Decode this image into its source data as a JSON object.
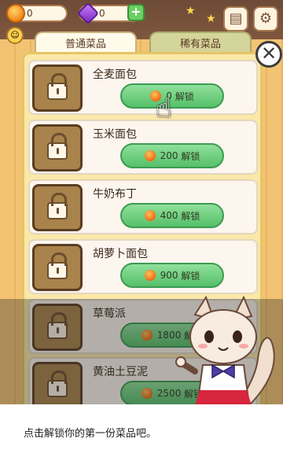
{
  "hud": {
    "coins": "0",
    "gems": "0",
    "plus": "+",
    "face": "☺",
    "icons": [
      "ticket-icon",
      "gear-icon"
    ]
  },
  "tabs": [
    {
      "label": "普通菜品",
      "active": true
    },
    {
      "label": "稀有菜品",
      "active": false
    }
  ],
  "close_label": "✕",
  "items": [
    {
      "name": "全麦面包",
      "price": "0",
      "action": "解锁"
    },
    {
      "name": "玉米面包",
      "price": "200",
      "action": "解锁"
    },
    {
      "name": "牛奶布丁",
      "price": "400",
      "action": "解锁"
    },
    {
      "name": "胡萝卜面包",
      "price": "900",
      "action": "解锁"
    },
    {
      "name": "草莓派",
      "price": "1800",
      "action": "解锁"
    },
    {
      "name": "黄油土豆泥",
      "price": "2500",
      "action": "解锁"
    }
  ],
  "tutorial": {
    "text": "点击解锁你的第一份菜品吧。"
  },
  "colors": {
    "unlock_button": "#56c06a",
    "panel": "#f9e8a8",
    "coin": "#ef6a15"
  }
}
